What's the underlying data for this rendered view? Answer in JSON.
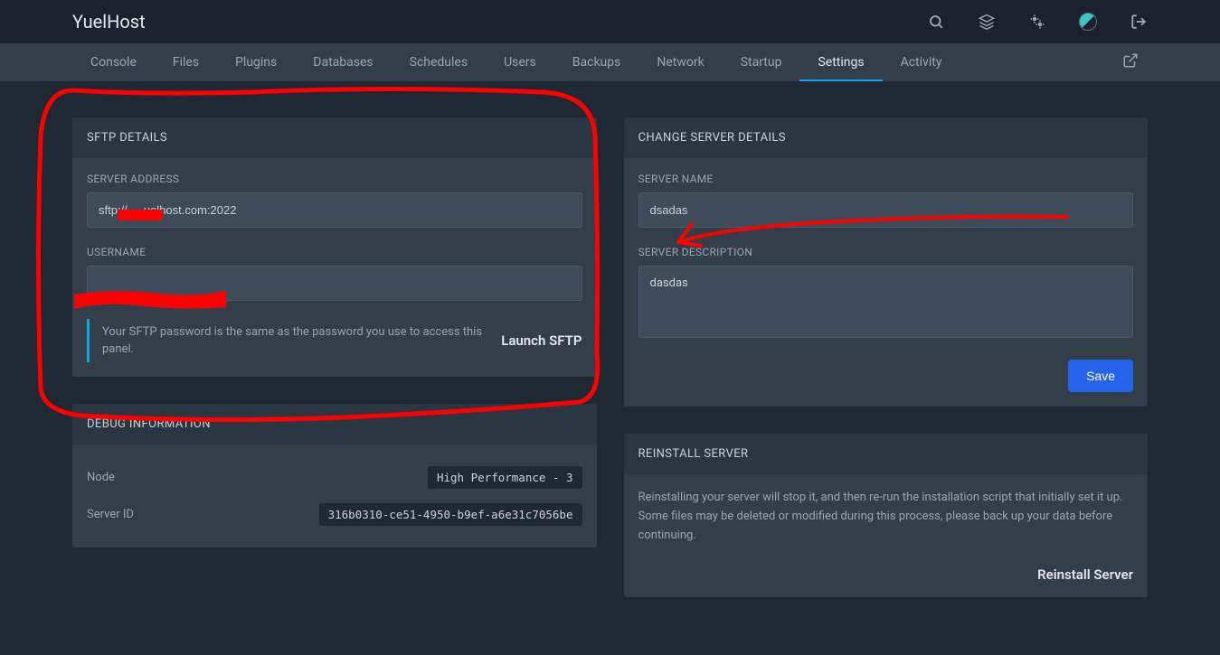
{
  "brand": "YuelHost",
  "nav": {
    "items": [
      "Console",
      "Files",
      "Plugins",
      "Databases",
      "Schedules",
      "Users",
      "Backups",
      "Network",
      "Startup",
      "Settings",
      "Activity"
    ],
    "active_index": 9
  },
  "sftp": {
    "title": "SFTP DETAILS",
    "address_label": "SERVER ADDRESS",
    "address_value": "sftp://     uelhost.com:2022",
    "username_label": "USERNAME",
    "username_value": "",
    "note": "Your SFTP password is the same as the password you use to access this panel.",
    "launch_btn": "Launch SFTP"
  },
  "debug": {
    "title": "DEBUG INFORMATION",
    "node_label": "Node",
    "node_value": "High Performance - 3",
    "server_id_label": "Server ID",
    "server_id_value": "316b0310-ce51-4950-b9ef-a6e31c7056be"
  },
  "change": {
    "title": "CHANGE SERVER DETAILS",
    "name_label": "SERVER NAME",
    "name_value": "dsadas",
    "desc_label": "SERVER DESCRIPTION",
    "desc_value": "dasdas",
    "save_btn": "Save"
  },
  "reinstall": {
    "title": "REINSTALL SERVER",
    "text": "Reinstalling your server will stop it, and then re-run the installation script that initially set it up. Some files may be deleted or modified during this process, please back up your data before continuing.",
    "btn": "Reinstall Server"
  }
}
